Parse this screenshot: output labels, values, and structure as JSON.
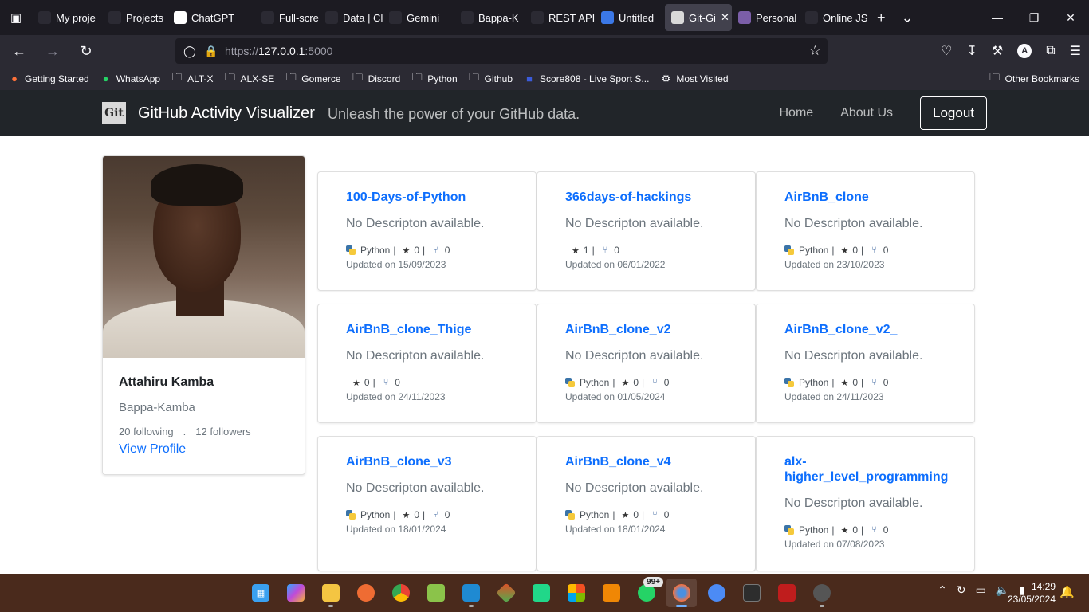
{
  "browser": {
    "tabs": [
      {
        "label": "My proje",
        "icon": "tab-favicon-icon",
        "color": "#2b2a33"
      },
      {
        "label": "Projects |",
        "icon": "tab-favicon-icon",
        "color": "#2b2a33"
      },
      {
        "label": "ChatGPT",
        "icon": "chatgpt-icon",
        "color": "#ffffff"
      },
      {
        "label": "Full-scre",
        "icon": "tab-favicon-icon",
        "color": "#2b2a33"
      },
      {
        "label": "Data | Cl",
        "icon": "leaf-icon",
        "color": "#2b2a33"
      },
      {
        "label": "Gemini",
        "icon": "gemini-icon",
        "color": "#2b2a33"
      },
      {
        "label": "Bappa-K",
        "icon": "github-icon",
        "color": "#2b2a33"
      },
      {
        "label": "REST API",
        "icon": "github-icon",
        "color": "#2b2a33"
      },
      {
        "label": "Untitled",
        "icon": "docs-icon",
        "color": "#3b78e7"
      },
      {
        "label": "Git-Gi",
        "icon": "git-favicon-icon",
        "color": "#d9d9d9",
        "active": true
      },
      {
        "label": "Personal",
        "icon": "hostinger-icon",
        "color": "#7b5ea8"
      },
      {
        "label": "Online JS",
        "icon": "opera-icon",
        "color": "#2b2a33"
      }
    ],
    "url_scheme": "https://",
    "url_host": "127.0.0.1",
    "url_port": ":5000",
    "bookmarks": [
      {
        "label": "Getting Started",
        "icon": "firefox-icon"
      },
      {
        "label": "WhatsApp",
        "icon": "whatsapp-icon"
      },
      {
        "label": "ALT-X",
        "icon": "folder-icon"
      },
      {
        "label": "ALX-SE",
        "icon": "folder-icon"
      },
      {
        "label": "Gomerce",
        "icon": "folder-icon"
      },
      {
        "label": "Discord",
        "icon": "folder-icon"
      },
      {
        "label": "Python",
        "icon": "folder-icon"
      },
      {
        "label": "Github",
        "icon": "folder-icon"
      },
      {
        "label": "Score808 - Live Sport S...",
        "icon": "score-icon"
      },
      {
        "label": "Most Visited",
        "icon": "gear-icon"
      }
    ],
    "other_bookmarks": "Other Bookmarks"
  },
  "header": {
    "logo_text": "Git",
    "brand": "GitHub Activity Visualizer",
    "tagline": "Unleash the power of your GitHub data.",
    "nav": {
      "home": "Home",
      "about": "About Us",
      "logout": "Logout"
    }
  },
  "profile": {
    "name": "Attahiru Kamba",
    "username": "Bappa-Kamba",
    "following": "20 following",
    "separator": ".",
    "followers": "12 followers",
    "link": "View Profile"
  },
  "repos": [
    {
      "name": "100-Days-of-Python",
      "desc": "No Descripton available.",
      "lang": "Python",
      "stars": "0",
      "forks": "0",
      "updated": "Updated on 15/09/2023"
    },
    {
      "name": "366days-of-hackings",
      "desc": "No Descripton available.",
      "lang": "",
      "stars": "1",
      "forks": "0",
      "updated": "Updated on 06/01/2022"
    },
    {
      "name": "AirBnB_clone",
      "desc": "No Descripton available.",
      "lang": "Python",
      "stars": "0",
      "forks": "0",
      "updated": "Updated on 23/10/2023"
    },
    {
      "name": "AirBnB_clone_Thige",
      "desc": "No Descripton available.",
      "lang": "",
      "stars": "0",
      "forks": "0",
      "updated": "Updated on 24/11/2023"
    },
    {
      "name": "AirBnB_clone_v2",
      "desc": "No Descripton available.",
      "lang": "Python",
      "stars": "0",
      "forks": "0",
      "updated": "Updated on 01/05/2024"
    },
    {
      "name": "AirBnB_clone_v2_",
      "desc": "No Descripton available.",
      "lang": "Python",
      "stars": "0",
      "forks": "0",
      "updated": "Updated on 24/11/2023"
    },
    {
      "name": "AirBnB_clone_v3",
      "desc": "No Descripton available.",
      "lang": "Python",
      "stars": "0",
      "forks": "0",
      "updated": "Updated on 18/01/2024"
    },
    {
      "name": "AirBnB_clone_v4",
      "desc": "No Descripton available.",
      "lang": "Python",
      "stars": "0",
      "forks": "0",
      "updated": "Updated on 18/01/2024"
    },
    {
      "name": "alx-higher_level_programming",
      "desc": "No Descripton available.",
      "lang": "Python",
      "stars": "0",
      "forks": "0",
      "updated": "Updated on 07/08/2023"
    }
  ],
  "taskbar": {
    "badge": "99+",
    "time": "14:29",
    "date": "23/05/2024"
  },
  "colors": {
    "accent": "#0d6efd",
    "header_bg": "#212529",
    "taskbar_bg": "#4a2a1c"
  }
}
